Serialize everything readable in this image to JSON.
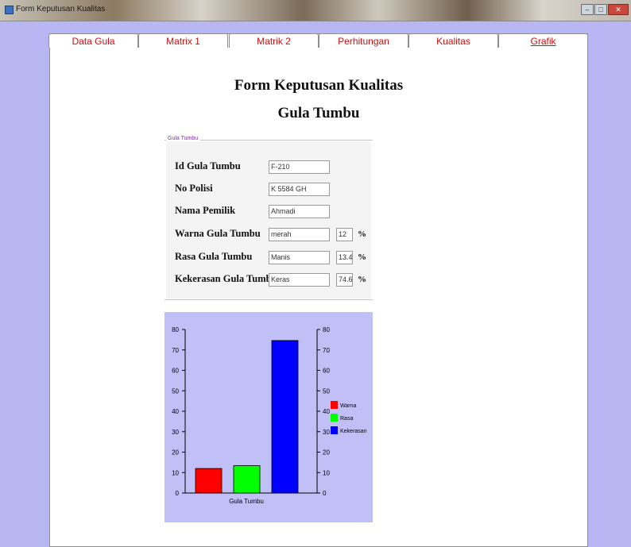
{
  "window": {
    "title": "Form Keputusan Kualitas",
    "buttons": [
      "–",
      "□",
      "✕"
    ]
  },
  "tabs": [
    {
      "label": "Data Gula",
      "active": false
    },
    {
      "label": "Matrix 1",
      "active": false
    },
    {
      "label": "Matrik 2",
      "active": false
    },
    {
      "label": "Perhitungan",
      "active": false
    },
    {
      "label": "Kualitas",
      "active": false
    },
    {
      "label": "Grafik",
      "active": true
    }
  ],
  "form": {
    "title": "Form Keputusan Kualitas",
    "subtitle": "Gula Tumbu",
    "group_label": "Gula Tumbu",
    "fields": {
      "id": {
        "label": "Id Gula Tumbu",
        "value": "F-210"
      },
      "polisi": {
        "label": "No Polisi",
        "value": "K 5584 GH"
      },
      "pemilik": {
        "label": "Nama Pemilik",
        "value": "Ahmadi"
      },
      "warna": {
        "label": "Warna Gula Tumbu",
        "value": "merah",
        "percent": "12",
        "unit": "%"
      },
      "rasa": {
        "label": "Rasa Gula Tumbu",
        "value": "Manis",
        "percent": "13.4",
        "unit": "%"
      },
      "kekerasan": {
        "label": "Kekerasan Gula Tumbu",
        "value": "Keras",
        "percent": "74.6",
        "unit": "%"
      }
    }
  },
  "chart_data": {
    "type": "bar",
    "categories": [
      "Gula Tumbu"
    ],
    "series": [
      {
        "name": "Warna",
        "values": [
          12
        ],
        "color": "#ff0000"
      },
      {
        "name": "Rasa",
        "values": [
          13.4
        ],
        "color": "#00ff00"
      },
      {
        "name": "Kekerasan",
        "values": [
          74.6
        ],
        "color": "#0000ff"
      }
    ],
    "xlabel": "Gula Tumbu",
    "ylim": [
      0,
      80
    ],
    "yticks": [
      0,
      10,
      20,
      30,
      40,
      50,
      60,
      70,
      80
    ],
    "grid": false,
    "legend": "right"
  }
}
